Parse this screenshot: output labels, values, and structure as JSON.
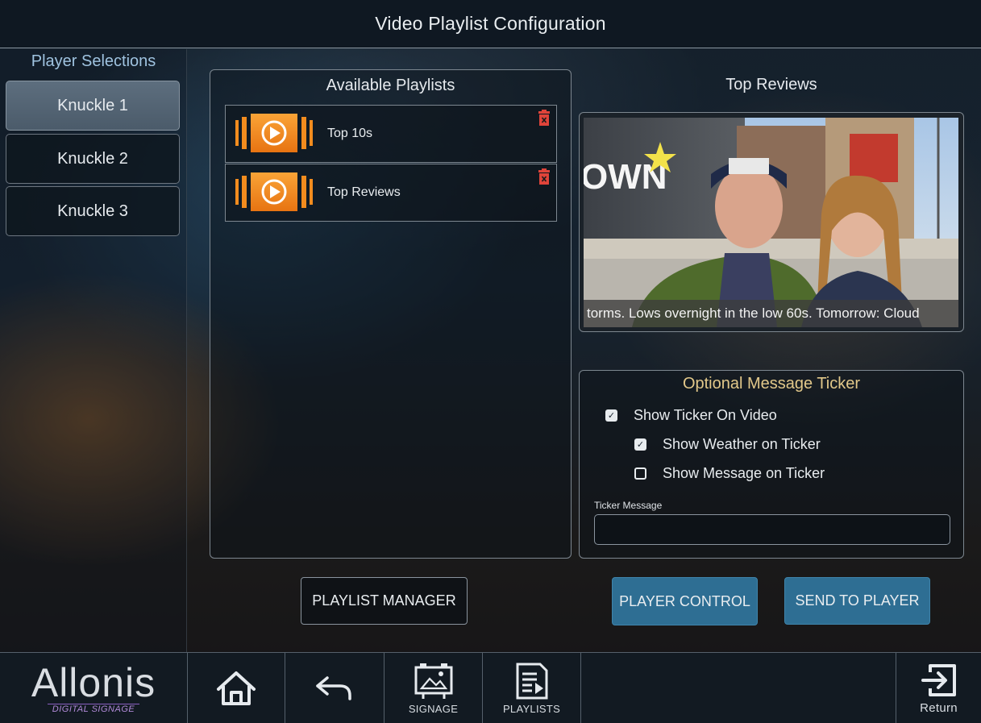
{
  "header": {
    "title": "Video Playlist Configuration"
  },
  "players": {
    "title": "Player Selections",
    "items": [
      {
        "label": "Knuckle 1",
        "selected": true
      },
      {
        "label": "Knuckle 2",
        "selected": false
      },
      {
        "label": "Knuckle 3",
        "selected": false
      }
    ]
  },
  "playlists": {
    "title": "Available Playlists",
    "items": [
      {
        "label": "Top 10s",
        "thumb_icon": "play-playlist-icon",
        "delete_icon": "trash-icon"
      },
      {
        "label": "Top Reviews",
        "thumb_icon": "play-playlist-icon",
        "delete_icon": "trash-icon"
      }
    ]
  },
  "preview": {
    "title": "Top Reviews",
    "ticker_text": "torms. Lows overnight in the low 60s. Tomorrow: Cloud",
    "mural_text": "OWN"
  },
  "ticker": {
    "title": "Optional Message Ticker",
    "show_on_video": {
      "label": "Show Ticker On Video",
      "checked": true
    },
    "show_weather": {
      "label": "Show Weather on Ticker",
      "checked": true
    },
    "show_message": {
      "label": "Show Message on Ticker",
      "checked": false
    },
    "message_label": "Ticker Message",
    "message_value": ""
  },
  "buttons": {
    "playlist_manager": "PLAYLIST MANAGER",
    "player_control": "PLAYER CONTROL",
    "send_to_player": "SEND TO PLAYER"
  },
  "nav": {
    "logo_text": "Allonis",
    "logo_sub": "DIGITAL SIGNAGE",
    "home_icon": "home-icon",
    "back_icon": "back-arrow-icon",
    "signage_label": "SIGNAGE",
    "playlists_label": "PLAYLISTS",
    "return_label": "Return"
  },
  "colors": {
    "accent_blue": "#2e6e93",
    "ticker_title": "#e2c88a",
    "player_title": "#9fc3e0",
    "trash_red": "#e0443a",
    "thumb_orange": "#f28c1e"
  }
}
